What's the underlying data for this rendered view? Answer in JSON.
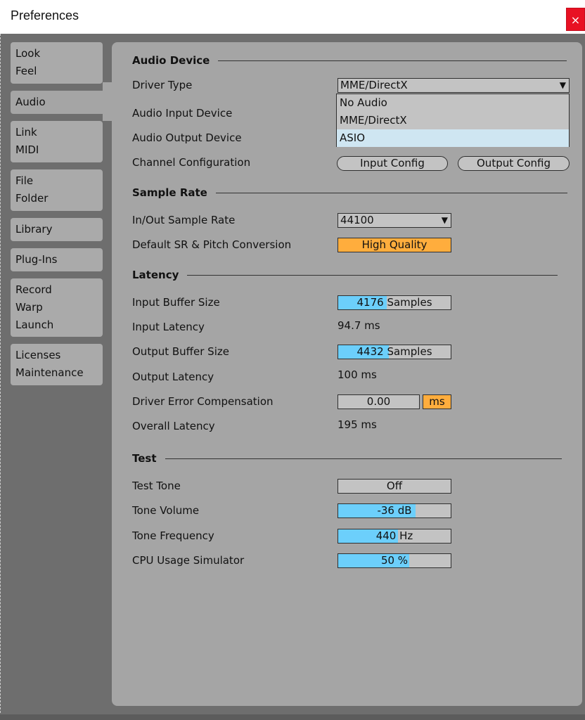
{
  "window": {
    "title": "Preferences",
    "close_label": "×"
  },
  "sidebar": {
    "tabs": [
      {
        "lines": [
          "Look",
          "Feel"
        ]
      },
      {
        "lines": [
          "Audio"
        ]
      },
      {
        "lines": [
          "Link",
          "MIDI"
        ]
      },
      {
        "lines": [
          "File",
          "Folder"
        ]
      },
      {
        "lines": [
          "Library"
        ]
      },
      {
        "lines": [
          "Plug-Ins"
        ]
      },
      {
        "lines": [
          "Record",
          "Warp",
          "Launch"
        ]
      },
      {
        "lines": [
          "Licenses",
          "Maintenance"
        ]
      }
    ],
    "active_tab": "Audio"
  },
  "audio_device": {
    "heading": "Audio Device",
    "driver_type_label": "Driver Type",
    "driver_type_value": "MME/DirectX",
    "driver_options": [
      "No Audio",
      "MME/DirectX",
      "ASIO"
    ],
    "highlighted_option": "ASIO",
    "input_device_label": "Audio Input Device",
    "output_device_label": "Audio Output Device",
    "channel_config_label": "Channel Configuration",
    "input_config_button": "Input Config",
    "output_config_button": "Output Config"
  },
  "sample_rate": {
    "heading": "Sample Rate",
    "inout_label": "In/Out Sample Rate",
    "inout_value": "44100",
    "conversion_label": "Default SR & Pitch Conversion",
    "conversion_value": "High Quality"
  },
  "latency": {
    "heading": "Latency",
    "input_buffer_label": "Input Buffer Size",
    "input_buffer_value": "4176",
    "input_buffer_unit": "Samples",
    "input_buffer_fill": 0.43,
    "input_latency_label": "Input Latency",
    "input_latency_value": "94.7 ms",
    "output_buffer_label": "Output Buffer Size",
    "output_buffer_value": "4432",
    "output_buffer_unit": "Samples",
    "output_buffer_fill": 0.45,
    "output_latency_label": "Output Latency",
    "output_latency_value": "100 ms",
    "error_comp_label": "Driver Error Compensation",
    "error_comp_value": "0.00",
    "error_comp_unit": "ms",
    "overall_label": "Overall Latency",
    "overall_value": "195 ms"
  },
  "test": {
    "heading": "Test",
    "tone_label": "Test Tone",
    "tone_value": "Off",
    "volume_label": "Tone Volume",
    "volume_value": "-36 dB",
    "volume_fill": 0.69,
    "frequency_label": "Tone Frequency",
    "frequency_value": "440 Hz",
    "frequency_fill": 0.53,
    "cpu_label": "CPU Usage Simulator",
    "cpu_value": "50 %",
    "cpu_fill": 0.63
  },
  "colors": {
    "accent_blue": "#6ccffb",
    "accent_orange": "#ffad3d",
    "panel_grey": "#a5a5a5",
    "background": "#6e6e6e",
    "close_red": "#e81123"
  }
}
